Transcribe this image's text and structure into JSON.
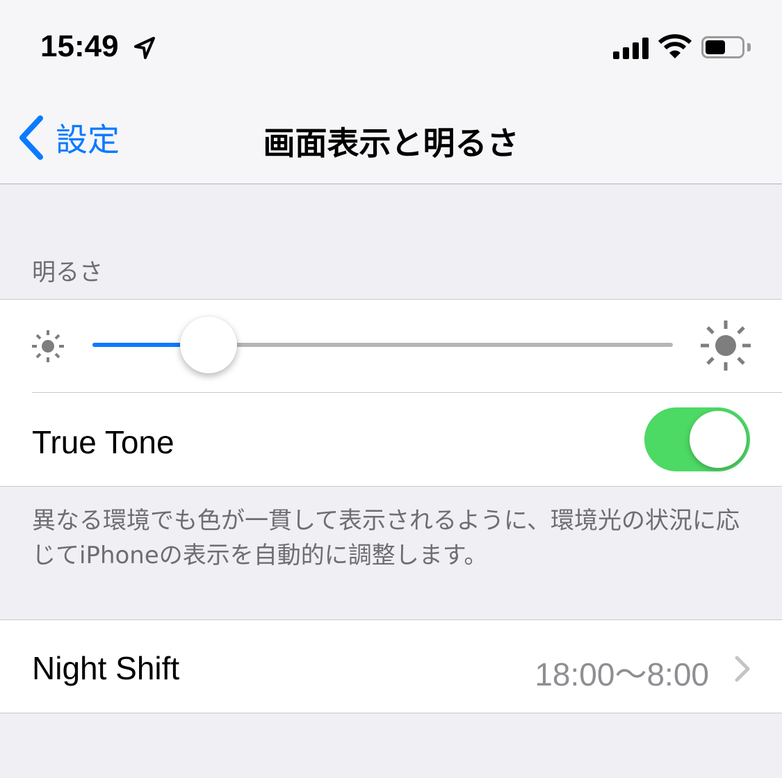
{
  "status_bar": {
    "time": "15:49",
    "location_icon": "location-arrow-icon",
    "signal_icon": "cellular-signal-icon",
    "wifi_icon": "wifi-icon",
    "battery_icon": "battery-icon",
    "battery_level": 0.5
  },
  "nav": {
    "back_label": "設定",
    "title": "画面表示と明るさ"
  },
  "brightness": {
    "section_header": "明るさ",
    "slider_value": 0.2,
    "accent": "#0a7aff",
    "min_icon": "sun-small-icon",
    "max_icon": "sun-large-icon"
  },
  "true_tone": {
    "label": "True Tone",
    "enabled": true,
    "toggle_color": "#4cd964",
    "footer": "異なる環境でも色が一貫して表示されるように、環境光の状況に応じてiPhoneの表示を自動的に調整します。"
  },
  "night_shift": {
    "label": "Night Shift",
    "value": "18:00〜8:00"
  }
}
